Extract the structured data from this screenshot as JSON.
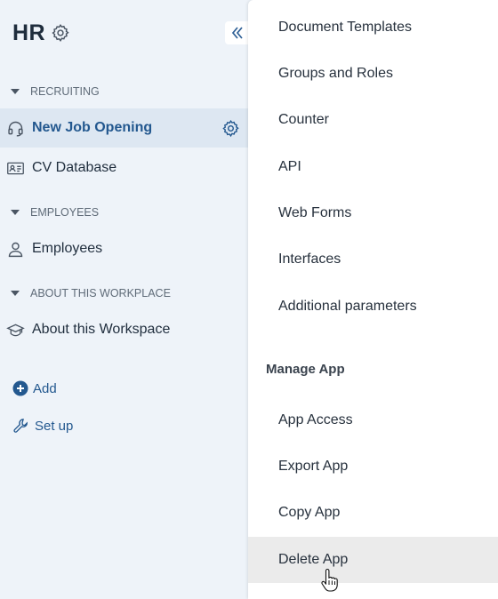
{
  "app": {
    "title": "HR"
  },
  "sidebar": {
    "sections": [
      {
        "header": "RECRUITING",
        "items": [
          {
            "label": "New Job Opening",
            "icon": "headset-icon",
            "active": true
          },
          {
            "label": "CV Database",
            "icon": "id-card-icon",
            "active": false
          }
        ]
      },
      {
        "header": "EMPLOYEES",
        "items": [
          {
            "label": "Employees",
            "icon": "person-icon",
            "active": false
          }
        ]
      },
      {
        "header": "ABOUT THIS WORKPLACE",
        "items": [
          {
            "label": "About this Workspace",
            "icon": "graduation-cap-icon",
            "active": false
          }
        ]
      }
    ],
    "actions": {
      "add_label": "Add",
      "setup_label": "Set up"
    }
  },
  "menu": {
    "items": [
      "Document Templates",
      "Groups and Roles",
      "Counter",
      "API",
      "Web Forms",
      "Interfaces",
      "Additional parameters"
    ],
    "manage_heading": "Manage App",
    "manage_items": [
      "App Access",
      "Export App",
      "Copy App",
      "Delete App"
    ],
    "hovered_item": "Delete App"
  },
  "colors": {
    "sidebar_bg": "#eef3f9",
    "active_bg": "#dde7f2",
    "accent": "#23588f",
    "menu_hover": "#ebebeb"
  }
}
